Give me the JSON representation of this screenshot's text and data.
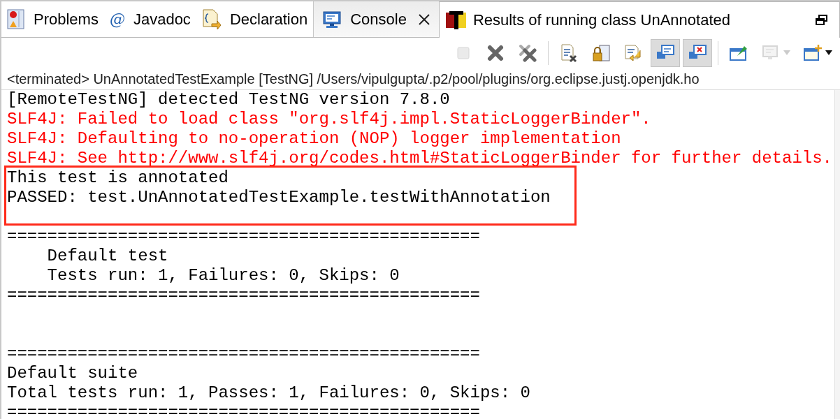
{
  "tabs": [
    {
      "label": "Problems",
      "selected": false
    },
    {
      "glyph": "@",
      "label": "Javadoc",
      "selected": false
    },
    {
      "label": "Declaration",
      "selected": false
    },
    {
      "label": "Console",
      "selected": true
    }
  ],
  "results_tab": {
    "label": "Results of running class UnAnnotated"
  },
  "toolbar": [
    {
      "kind": "stop",
      "disabled": true,
      "selected": false,
      "dropdown": false
    },
    {
      "kind": "remove",
      "disabled": false,
      "selected": false,
      "dropdown": false
    },
    {
      "kind": "remove-all",
      "disabled": false,
      "selected": false,
      "dropdown": false,
      "separator_after": true
    },
    {
      "kind": "clear",
      "disabled": false,
      "selected": false,
      "dropdown": false
    },
    {
      "kind": "scroll-lock",
      "disabled": false,
      "selected": false,
      "dropdown": false
    },
    {
      "kind": "word-wrap",
      "disabled": false,
      "selected": false,
      "dropdown": false
    },
    {
      "kind": "stdout",
      "disabled": false,
      "selected": true,
      "dropdown": false
    },
    {
      "kind": "stderr",
      "disabled": false,
      "selected": true,
      "dropdown": false,
      "separator_after": true
    },
    {
      "kind": "pin",
      "disabled": false,
      "selected": false,
      "dropdown": false
    },
    {
      "kind": "display",
      "disabled": true,
      "selected": false,
      "dropdown": true
    },
    {
      "kind": "new-console",
      "disabled": false,
      "selected": false,
      "dropdown": true
    }
  ],
  "process_label": "<terminated> UnAnnotatedTestExample [TestNG] /Users/vipulgupta/.p2/pool/plugins/org.eclipse.justj.openjdk.ho",
  "console_blocks": [
    {
      "lines": [
        {
          "text": "[RemoteTestNG] detected TestNG version 7.8.0",
          "error": false
        },
        {
          "text": "SLF4J: Failed to load class \"org.slf4j.impl.StaticLoggerBinder\".",
          "error": true
        },
        {
          "text": "SLF4J: Defaulting to no-operation (NOP) logger implementation",
          "error": true
        },
        {
          "text": "SLF4J: See http://www.slf4j.org/codes.html#StaticLoggerBinder for further details.",
          "error": true
        },
        {
          "text": "This test is annotated",
          "error": false
        },
        {
          "text": "PASSED: test.UnAnnotatedTestExample.testWithAnnotation",
          "error": false
        }
      ]
    },
    {
      "lines": [
        {
          "text": "===============================================",
          "error": false
        },
        {
          "text": "    Default test",
          "error": false
        },
        {
          "text": "    Tests run: 1, Failures: 0, Skips: 0",
          "error": false
        },
        {
          "text": "===============================================",
          "error": false
        }
      ]
    },
    {
      "lines": [
        {
          "text": "===============================================",
          "error": false
        },
        {
          "text": "Default suite",
          "error": false
        },
        {
          "text": "Total tests run: 1, Passes: 1, Failures: 0, Skips: 0",
          "error": false
        },
        {
          "text": "===============================================",
          "error": false
        }
      ]
    }
  ]
}
